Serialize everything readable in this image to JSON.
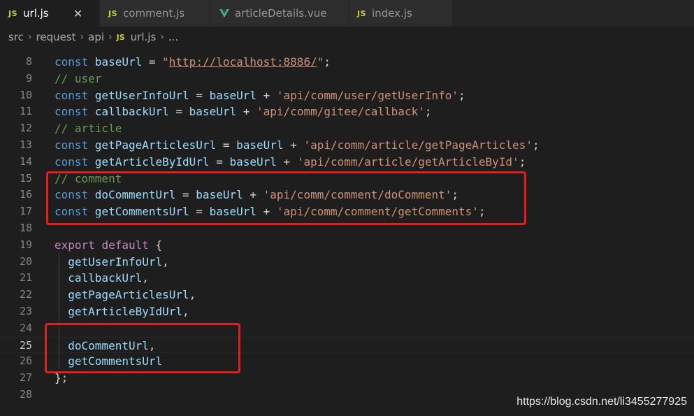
{
  "tabs": [
    {
      "label": "url.js",
      "icon": "js-icon",
      "active": true,
      "close": "✕"
    },
    {
      "label": "comment.js",
      "icon": "js-icon"
    },
    {
      "label": "articleDetails.vue",
      "icon": "vue-icon"
    },
    {
      "label": "index.js",
      "icon": "js-icon"
    }
  ],
  "breadcrumb": {
    "parts": [
      "src",
      "request",
      "api"
    ],
    "file": "url.js",
    "ellipsis": "..."
  },
  "icon_text": {
    "js": "JS"
  },
  "lines": [
    {
      "n": "8",
      "tokens": [
        [
          "kw",
          "const "
        ],
        [
          "var",
          "baseUrl"
        ],
        [
          "op",
          " = "
        ],
        [
          "str",
          "\""
        ],
        [
          "url",
          "http://localhost:8886/"
        ],
        [
          "str",
          "\""
        ],
        [
          "op",
          ";"
        ]
      ]
    },
    {
      "n": "9",
      "tokens": [
        [
          "cmt",
          "// user"
        ]
      ]
    },
    {
      "n": "10",
      "tokens": [
        [
          "kw",
          "const "
        ],
        [
          "var",
          "getUserInfoUrl"
        ],
        [
          "op",
          " = "
        ],
        [
          "var",
          "baseUrl"
        ],
        [
          "op",
          " + "
        ],
        [
          "str",
          "'api/comm/user/getUserInfo'"
        ],
        [
          "op",
          ";"
        ]
      ]
    },
    {
      "n": "11",
      "tokens": [
        [
          "kw",
          "const "
        ],
        [
          "var",
          "callbackUrl"
        ],
        [
          "op",
          " = "
        ],
        [
          "var",
          "baseUrl"
        ],
        [
          "op",
          " + "
        ],
        [
          "str",
          "'api/comm/gitee/callback'"
        ],
        [
          "op",
          ";"
        ]
      ]
    },
    {
      "n": "12",
      "tokens": [
        [
          "cmt",
          "// article"
        ]
      ]
    },
    {
      "n": "13",
      "tokens": [
        [
          "kw",
          "const "
        ],
        [
          "var",
          "getPageArticlesUrl"
        ],
        [
          "op",
          " = "
        ],
        [
          "var",
          "baseUrl"
        ],
        [
          "op",
          " + "
        ],
        [
          "str",
          "'api/comm/article/getPageArticles'"
        ],
        [
          "op",
          ";"
        ]
      ]
    },
    {
      "n": "14",
      "tokens": [
        [
          "kw",
          "const "
        ],
        [
          "var",
          "getArticleByIdUrl"
        ],
        [
          "op",
          " = "
        ],
        [
          "var",
          "baseUrl"
        ],
        [
          "op",
          " + "
        ],
        [
          "str",
          "'api/comm/article/getArticleById'"
        ],
        [
          "op",
          ";"
        ]
      ]
    },
    {
      "n": "15",
      "tokens": [
        [
          "cmt",
          "// comment"
        ]
      ]
    },
    {
      "n": "16",
      "tokens": [
        [
          "kw",
          "const "
        ],
        [
          "var",
          "doCommentUrl"
        ],
        [
          "op",
          " = "
        ],
        [
          "var",
          "baseUrl"
        ],
        [
          "op",
          " + "
        ],
        [
          "str",
          "'api/comm/comment/doComment'"
        ],
        [
          "op",
          ";"
        ]
      ]
    },
    {
      "n": "17",
      "tokens": [
        [
          "kw",
          "const "
        ],
        [
          "var",
          "getCommentsUrl"
        ],
        [
          "op",
          " = "
        ],
        [
          "var",
          "baseUrl"
        ],
        [
          "op",
          " + "
        ],
        [
          "str",
          "'api/comm/comment/getComments'"
        ],
        [
          "op",
          ";"
        ]
      ]
    },
    {
      "n": "18",
      "tokens": []
    },
    {
      "n": "19",
      "tokens": [
        [
          "kw2",
          "export "
        ],
        [
          "kw2",
          "default "
        ],
        [
          "op",
          "{"
        ]
      ]
    },
    {
      "n": "20",
      "tokens": [
        [
          "op",
          "  "
        ],
        [
          "var",
          "getUserInfoUrl"
        ],
        [
          "op",
          ","
        ]
      ]
    },
    {
      "n": "21",
      "tokens": [
        [
          "op",
          "  "
        ],
        [
          "var",
          "callbackUrl"
        ],
        [
          "op",
          ","
        ]
      ]
    },
    {
      "n": "22",
      "tokens": [
        [
          "op",
          "  "
        ],
        [
          "var",
          "getPageArticlesUrl"
        ],
        [
          "op",
          ","
        ]
      ]
    },
    {
      "n": "23",
      "tokens": [
        [
          "op",
          "  "
        ],
        [
          "var",
          "getArticleByIdUrl"
        ],
        [
          "op",
          ","
        ]
      ]
    },
    {
      "n": "24",
      "tokens": []
    },
    {
      "n": "25",
      "tokens": [
        [
          "op",
          "  "
        ],
        [
          "var",
          "doCommentUrl"
        ],
        [
          "op",
          ","
        ]
      ],
      "current": true
    },
    {
      "n": "26",
      "tokens": [
        [
          "op",
          "  "
        ],
        [
          "var",
          "getCommentsUrl"
        ]
      ]
    },
    {
      "n": "27",
      "tokens": [
        [
          "op",
          "};"
        ]
      ]
    },
    {
      "n": "28",
      "tokens": []
    }
  ],
  "watermark": "https://blog.csdn.net/li3455277925"
}
